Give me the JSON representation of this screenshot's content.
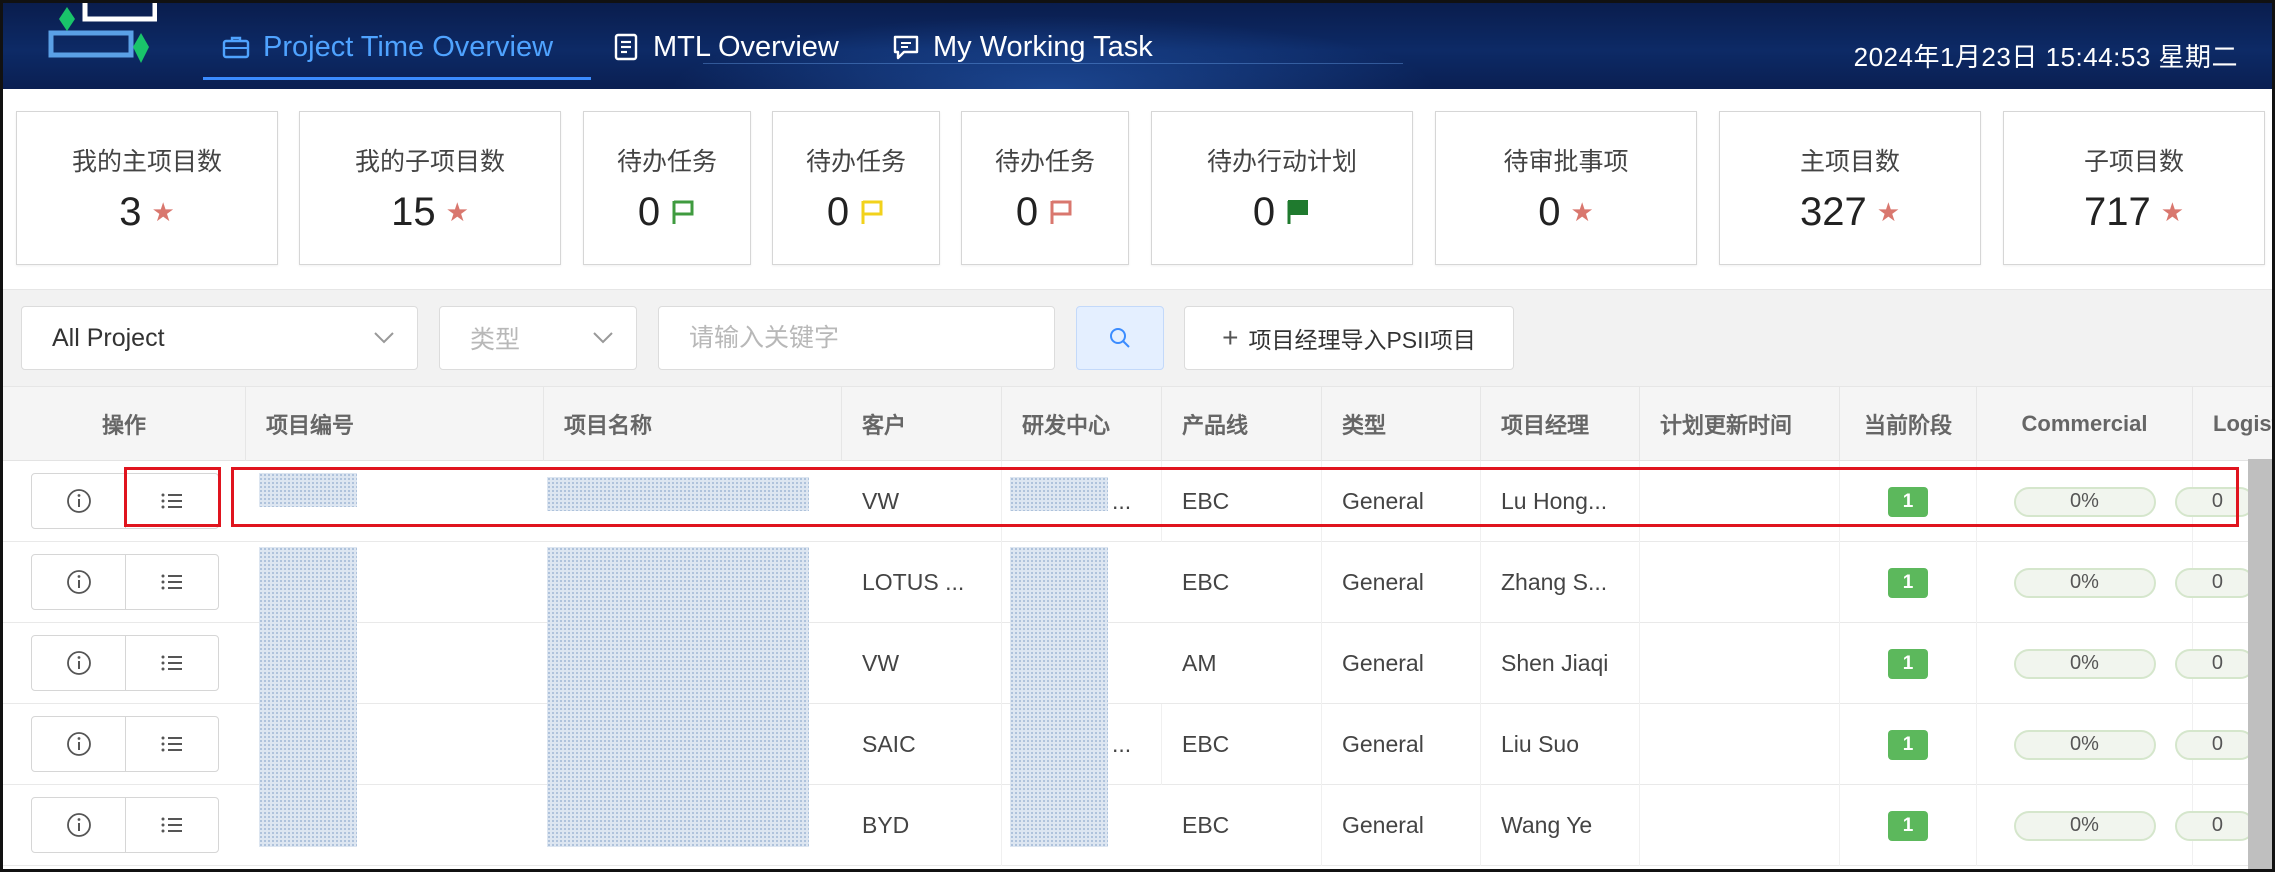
{
  "header": {
    "nav": [
      {
        "label": "Project Time Overview",
        "active": true,
        "icon": "briefcase-icon"
      },
      {
        "label": "MTL Overview",
        "active": false,
        "icon": "document-icon"
      },
      {
        "label": "My Working Task",
        "active": false,
        "icon": "chat-icon"
      }
    ],
    "datetime": "2024年1月23日  15:44:53  星期二",
    "colors": {
      "background": "#0d2a66",
      "active_tab": "#4fa3ff"
    }
  },
  "stats": [
    {
      "title": "我的主项目数",
      "value": "3",
      "marker": "star",
      "marker_color": "#d9776e"
    },
    {
      "title": "我的子项目数",
      "value": "15",
      "marker": "star",
      "marker_color": "#d9776e"
    },
    {
      "title": "待办任务",
      "value": "0",
      "marker": "flag-outline",
      "marker_color": "#3f9b3f"
    },
    {
      "title": "待办任务",
      "value": "0",
      "marker": "flag-outline",
      "marker_color": "#f2d21b"
    },
    {
      "title": "待办任务",
      "value": "0",
      "marker": "flag-outline",
      "marker_color": "#d9776e"
    },
    {
      "title": "待办行动计划",
      "value": "0",
      "marker": "flag-filled",
      "marker_color": "#1f7a2e"
    },
    {
      "title": "待审批事项",
      "value": "0",
      "marker": "star",
      "marker_color": "#d9776e"
    },
    {
      "title": "主项目数",
      "value": "327",
      "marker": "star",
      "marker_color": "#d9776e"
    },
    {
      "title": "子项目数",
      "value": "717",
      "marker": "star",
      "marker_color": "#d9776e"
    }
  ],
  "filters": {
    "project_select": "All Project",
    "type_select_placeholder": "类型",
    "keyword_placeholder": "请输入关键字",
    "import_button": "项目经理导入PSII项目"
  },
  "table": {
    "columns": [
      "操作",
      "项目编号",
      "项目名称",
      "客户",
      "研发中心",
      "产品线",
      "类型",
      "项目经理",
      "计划更新时间",
      "当前阶段",
      "Commercial",
      "Logistic"
    ],
    "rows": [
      {
        "customer": "VW",
        "center_suffix": "...",
        "product_line": "EBC",
        "type": "General",
        "manager": "Lu Hong...",
        "plan_update": "",
        "stage": "1",
        "commercial": "0%",
        "logistic": "0"
      },
      {
        "customer": "LOTUS ...",
        "center_suffix": "",
        "product_line": "EBC",
        "type": "General",
        "manager": "Zhang S...",
        "plan_update": "",
        "stage": "1",
        "commercial": "0%",
        "logistic": "0"
      },
      {
        "customer": "VW",
        "center_suffix": "",
        "product_line": "AM",
        "type": "General",
        "manager": "Shen Jiaqi",
        "plan_update": "",
        "stage": "1",
        "commercial": "0%",
        "logistic": "0"
      },
      {
        "customer": "SAIC",
        "center_suffix": "...",
        "product_line": "EBC",
        "type": "General",
        "manager": "Liu Suo",
        "plan_update": "",
        "stage": "1",
        "commercial": "0%",
        "logistic": "0"
      },
      {
        "customer": "BYD",
        "center_suffix": "",
        "product_line": "EBC",
        "type": "General",
        "manager": "Wang Ye",
        "plan_update": "",
        "stage": "1",
        "commercial": "0%",
        "logistic": "0"
      }
    ],
    "stage_color": "#5cb85c"
  }
}
